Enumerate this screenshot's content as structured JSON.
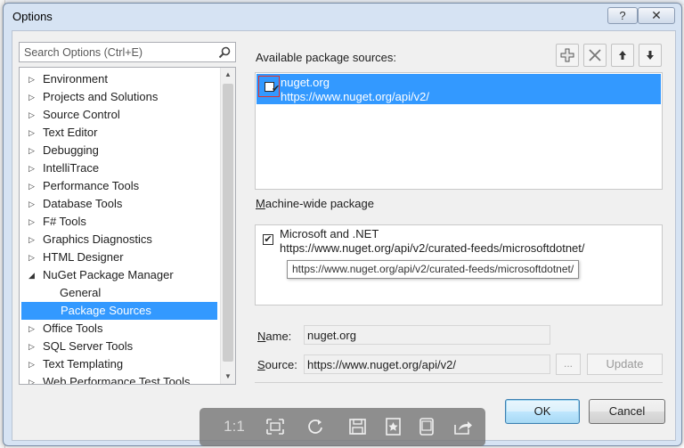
{
  "window": {
    "title": "Options",
    "help_label": "?",
    "close_label": "✕"
  },
  "search": {
    "placeholder": "Search Options (Ctrl+E)"
  },
  "tree": {
    "items": [
      {
        "label": "Environment",
        "expanded": false
      },
      {
        "label": "Projects and Solutions",
        "expanded": false
      },
      {
        "label": "Source Control",
        "expanded": false
      },
      {
        "label": "Text Editor",
        "expanded": false
      },
      {
        "label": "Debugging",
        "expanded": false
      },
      {
        "label": "IntelliTrace",
        "expanded": false
      },
      {
        "label": "Performance Tools",
        "expanded": false
      },
      {
        "label": "Database Tools",
        "expanded": false
      },
      {
        "label": "F# Tools",
        "expanded": false
      },
      {
        "label": "Graphics Diagnostics",
        "expanded": false
      },
      {
        "label": "HTML Designer",
        "expanded": false
      },
      {
        "label": "NuGet Package Manager",
        "expanded": true
      },
      {
        "label": "General",
        "child": true
      },
      {
        "label": "Package Sources",
        "child": true,
        "selected": true
      },
      {
        "label": "Office Tools",
        "expanded": false
      },
      {
        "label": "SQL Server Tools",
        "expanded": false
      },
      {
        "label": "Text Templating",
        "expanded": false
      },
      {
        "label": "Web Performance Test Tools",
        "expanded": false
      }
    ]
  },
  "package_sources": {
    "label": "Available package sources:",
    "sources": [
      {
        "name": "nuget.org",
        "url": "https://www.nuget.org/api/v2/",
        "checked": true
      }
    ]
  },
  "machine_wide": {
    "label_prefix": "M",
    "label_rest": "achine-wide package",
    "sources": [
      {
        "name": "Microsoft and .NET",
        "url": "https://www.nuget.org/api/v2/curated-feeds/microsoftdotnet/",
        "checked": true
      }
    ],
    "tooltip": "https://www.nuget.org/api/v2/curated-feeds/microsoftdotnet/"
  },
  "form": {
    "name_label_u": "N",
    "name_label_rest": "ame:",
    "name_value": "nuget.org",
    "source_label_u": "S",
    "source_label_rest": "ource:",
    "source_value": "https://www.nuget.org/api/v2/",
    "browse_label": "...",
    "update_label": "Update"
  },
  "buttons": {
    "ok": "OK",
    "cancel": "Cancel"
  },
  "viewer": {
    "ratio_label": "1:1"
  },
  "colors": {
    "selection": "#3399ff",
    "dialog_frame": "#d6e3f3",
    "highlight_border": "#e0322a"
  }
}
